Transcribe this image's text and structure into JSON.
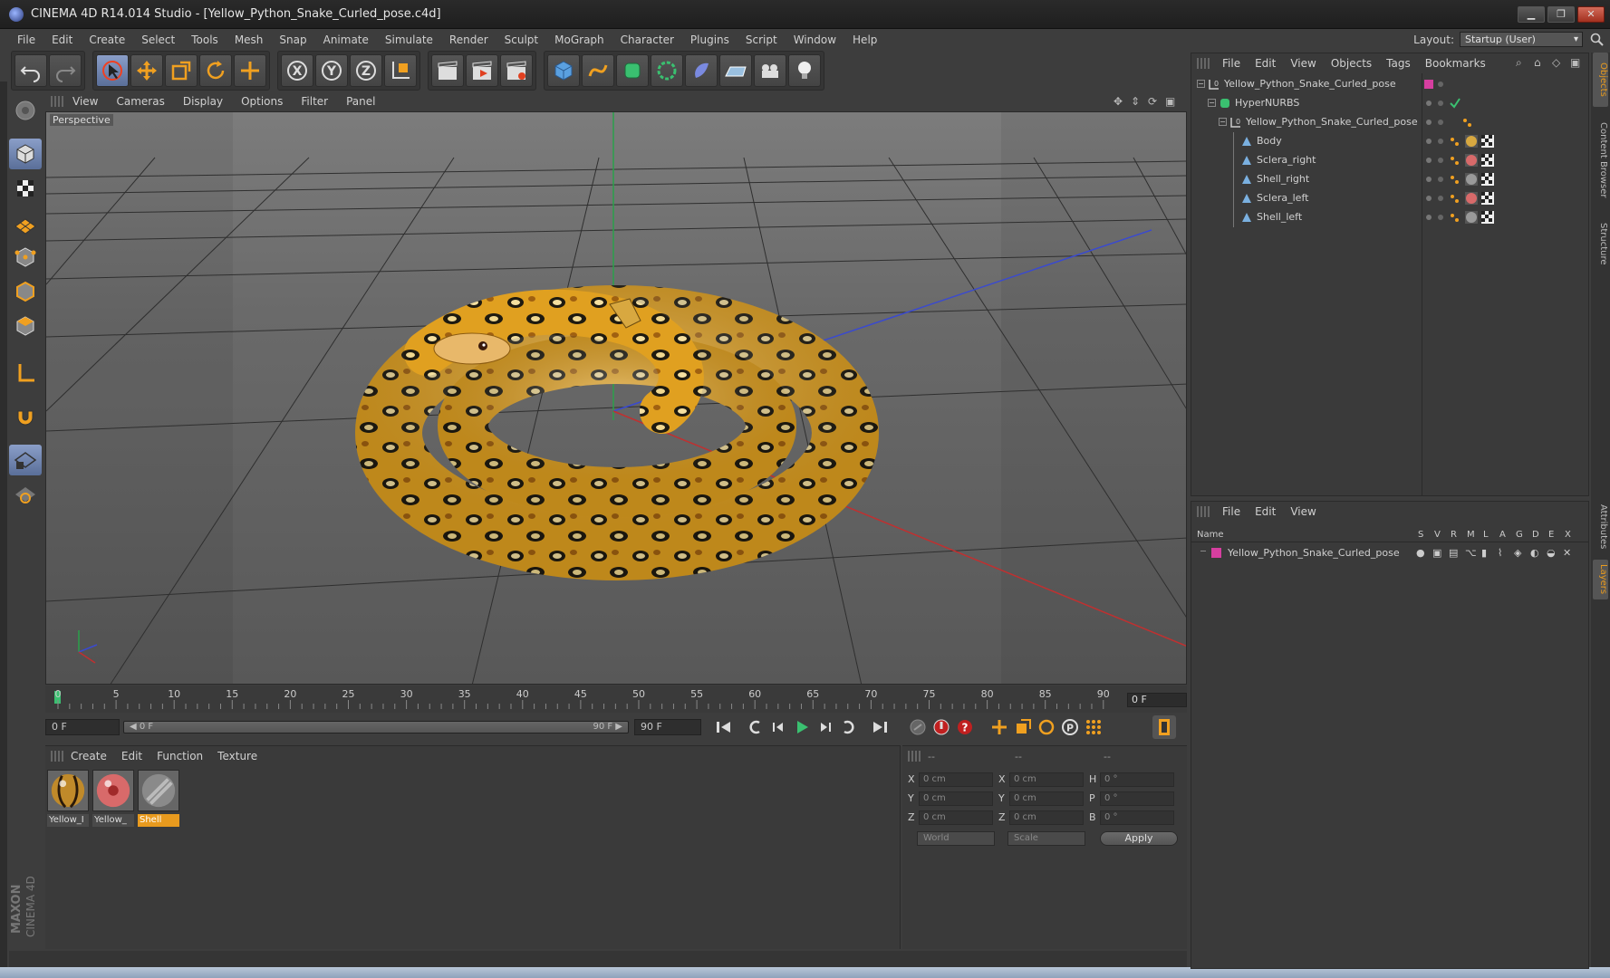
{
  "window": {
    "title": "CINEMA 4D R14.014 Studio - [Yellow_Python_Snake_Curled_pose.c4d]",
    "buttons": [
      "▁",
      "❐",
      "✕"
    ]
  },
  "menu": [
    "File",
    "Edit",
    "Create",
    "Select",
    "Tools",
    "Mesh",
    "Snap",
    "Animate",
    "Simulate",
    "Render",
    "Sculpt",
    "MoGraph",
    "Character",
    "Plugins",
    "Script",
    "Window",
    "Help"
  ],
  "layout": {
    "label": "Layout:",
    "value": "Startup (User)"
  },
  "viewport": {
    "menu": [
      "View",
      "Cameras",
      "Display",
      "Options",
      "Filter",
      "Panel"
    ],
    "label": "Perspective"
  },
  "timeline": {
    "ticks": [
      "0",
      "5",
      "10",
      "15",
      "20",
      "25",
      "30",
      "35",
      "40",
      "45",
      "50",
      "55",
      "60",
      "65",
      "70",
      "75",
      "80",
      "85",
      "90"
    ],
    "current_frame": "0 F"
  },
  "transport": {
    "start_field": "0 F",
    "range_left": "◀ 0 F",
    "range_right": "90 F ▶",
    "end_field": "90 F"
  },
  "materials": {
    "menu": [
      "Create",
      "Edit",
      "Function",
      "Texture"
    ],
    "items": [
      {
        "name": "Yellow_I",
        "selected": false
      },
      {
        "name": "Yellow_",
        "selected": false
      },
      {
        "name": "Shell",
        "selected": true
      }
    ]
  },
  "coordinates": {
    "headers": [
      "--",
      "--",
      "--"
    ],
    "rows": [
      {
        "l1": "X",
        "v1": "0 cm",
        "l2": "X",
        "v2": "0 cm",
        "l3": "H",
        "v3": "0 °"
      },
      {
        "l1": "Y",
        "v1": "0 cm",
        "l2": "Y",
        "v2": "0 cm",
        "l3": "P",
        "v3": "0 °"
      },
      {
        "l1": "Z",
        "v1": "0 cm",
        "l2": "Z",
        "v2": "0 cm",
        "l3": "B",
        "v3": "0 °"
      }
    ],
    "world": "World",
    "scale": "Scale",
    "apply": "Apply"
  },
  "objects": {
    "menu": [
      "File",
      "Edit",
      "View",
      "Objects",
      "Tags",
      "Bookmarks"
    ],
    "tree": [
      {
        "label": "Yellow_Python_Snake_Curled_pose",
        "depth": 0,
        "kind": "null"
      },
      {
        "label": "HyperNURBS",
        "depth": 1,
        "kind": "nurbs"
      },
      {
        "label": "Yellow_Python_Snake_Curled_pose",
        "depth": 2,
        "kind": "null"
      },
      {
        "label": "Body",
        "depth": 3,
        "kind": "poly"
      },
      {
        "label": "Sclera_right",
        "depth": 3,
        "kind": "poly"
      },
      {
        "label": "Shell_right",
        "depth": 3,
        "kind": "poly"
      },
      {
        "label": "Sclera_left",
        "depth": 3,
        "kind": "poly"
      },
      {
        "label": "Shell_left",
        "depth": 3,
        "kind": "poly"
      }
    ]
  },
  "layers": {
    "menu": [
      "File",
      "Edit",
      "View"
    ],
    "columns": [
      "Name",
      "S",
      "V",
      "R",
      "M",
      "L",
      "A",
      "G",
      "D",
      "E",
      "X"
    ],
    "row": "Yellow_Python_Snake_Curled_pose"
  },
  "side_tabs": [
    "Objects",
    "Content Browser",
    "Structure",
    "Attributes",
    "Layers"
  ],
  "brand": "MAXON CINEMA 4D",
  "colors": {
    "accent_orange": "#e89a1e",
    "active_tool": "#6f85b3",
    "layer_pink": "#d63fa0",
    "snake_yellow": "#e0a020"
  }
}
